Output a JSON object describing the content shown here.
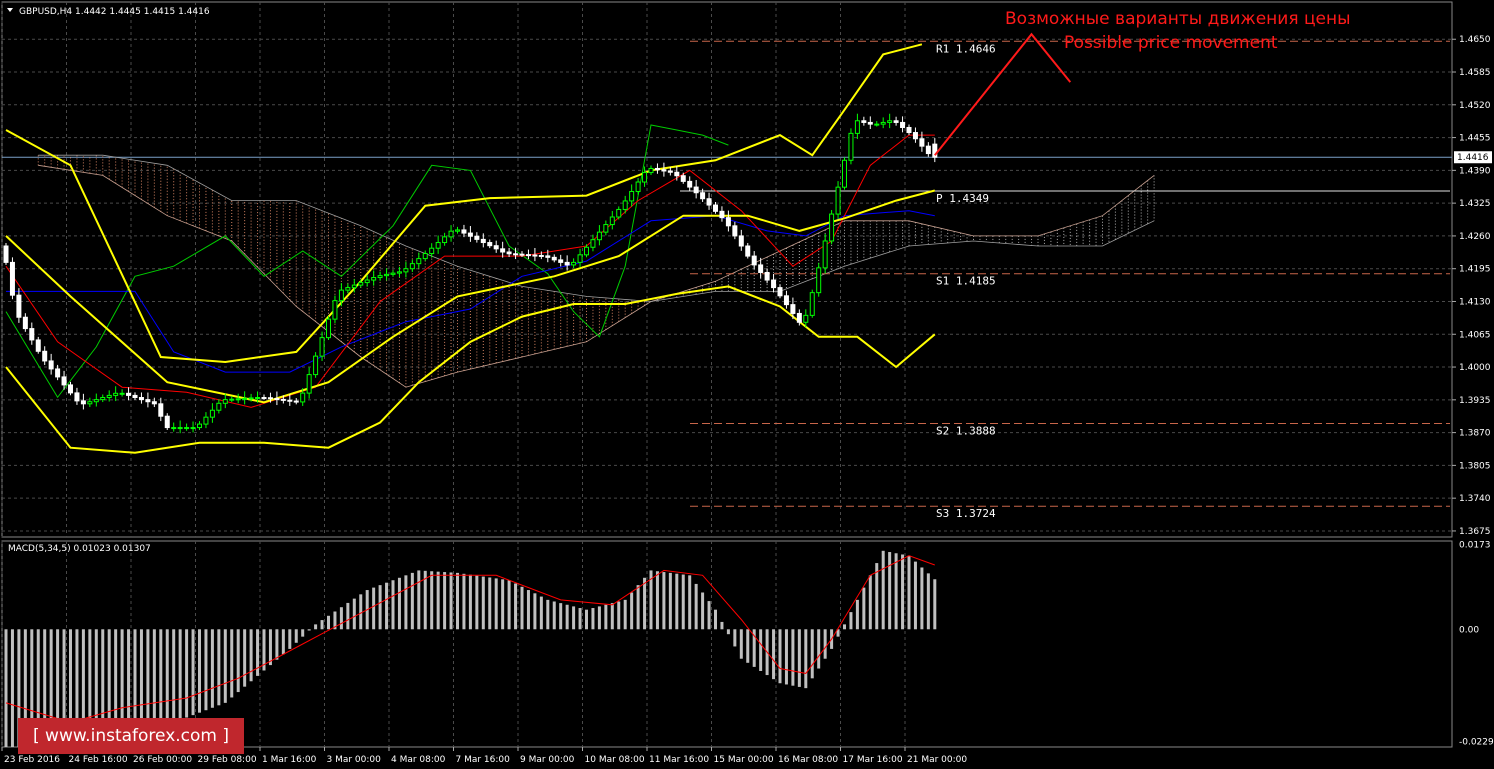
{
  "symbol_header": "GBPUSD,H4  1.4442 1.4445 1.4415 1.4416",
  "annotation": {
    "line_ru": "Возможные варианты движения цены",
    "line_en": "Possible price movement",
    "color": "#ff1a1a"
  },
  "watermark": "[ www.instaforex.com ]",
  "colors": {
    "background": "#000000",
    "grid": "#4a4a4a",
    "bull_candle": "#00ff00",
    "bear_candle": "#ffffff",
    "bollinger": "#ffff00",
    "tenkan": "#ff0000",
    "kijun": "#0000ff",
    "chikou": "#00cc00",
    "kumo_bull": "#b0b0b0",
    "kumo_bear": "#d08060",
    "pivot_lines": "#c8664a",
    "macd_hist": "#c0c0c0",
    "macd_signal": "#ff0000",
    "current_price_line": "#7aa0c8"
  },
  "chart_data": {
    "type": "candlestick",
    "symbol": "GBPUSD",
    "timeframe": "H4",
    "header_ohlc": {
      "open": 1.4442,
      "high": 1.4445,
      "low": 1.4415,
      "close": 1.4416
    },
    "current_price": 1.4416,
    "current_price_label": "1.4416",
    "price_axis": {
      "ylim": [
        1.3663,
        1.4704
      ],
      "ticks": [
        1.465,
        1.4585,
        1.452,
        1.4455,
        1.439,
        1.4325,
        1.426,
        1.4195,
        1.413,
        1.4065,
        1.4,
        1.3935,
        1.387,
        1.3805,
        1.374,
        1.3675
      ],
      "tick_labels": [
        "1.4650",
        "1.4585",
        "1.4520",
        "1.4455",
        "1.4390",
        "1.4325",
        "1.4260",
        "1.4195",
        "1.4130",
        "1.4065",
        "1.4000",
        "1.3935",
        "1.3870",
        "1.3805",
        "1.3740",
        "1.3675"
      ]
    },
    "time_axis": {
      "labels": [
        "23 Feb 2016",
        "24 Feb 16:00",
        "26 Feb 00:00",
        "29 Feb 08:00",
        "1 Mar 16:00",
        "3 Mar 00:00",
        "4 Mar 08:00",
        "7 Mar 16:00",
        "9 Mar 00:00",
        "10 Mar 08:00",
        "11 Mar 16:00",
        "15 Mar 00:00",
        "16 Mar 08:00",
        "17 Mar 16:00",
        "21 Mar 00:00"
      ],
      "label_bar_index": [
        0,
        10,
        20,
        30,
        40,
        50,
        60,
        70,
        80,
        90,
        100,
        110,
        120,
        130,
        140
      ],
      "bar_count": 145
    },
    "pivot_levels": [
      {
        "name": "R1",
        "value": 1.4646,
        "label": "R1 1.4646",
        "style": "dashed"
      },
      {
        "name": "P",
        "value": 1.4349,
        "label": "P 1.4349",
        "style": "solid"
      },
      {
        "name": "S1",
        "value": 1.4185,
        "label": "S1 1.4185",
        "style": "dashed"
      },
      {
        "name": "S2",
        "value": 1.3888,
        "label": "S2 1.3888",
        "style": "dashed"
      },
      {
        "name": "S3",
        "value": 1.3724,
        "label": "S3 1.3724",
        "style": "dashed"
      }
    ],
    "price_path_anchors": [
      [
        0,
        1.424
      ],
      [
        2,
        1.411
      ],
      [
        6,
        1.402
      ],
      [
        12,
        1.3925
      ],
      [
        18,
        1.395
      ],
      [
        24,
        1.3925
      ],
      [
        25,
        1.388
      ],
      [
        30,
        1.388
      ],
      [
        34,
        1.3935
      ],
      [
        40,
        1.394
      ],
      [
        46,
        1.393
      ],
      [
        52,
        1.415
      ],
      [
        58,
        1.418
      ],
      [
        62,
        1.419
      ],
      [
        66,
        1.423
      ],
      [
        70,
        1.4275
      ],
      [
        74,
        1.425
      ],
      [
        78,
        1.4225
      ],
      [
        84,
        1.422
      ],
      [
        88,
        1.42
      ],
      [
        92,
        1.426
      ],
      [
        96,
        1.432
      ],
      [
        100,
        1.4395
      ],
      [
        104,
        1.4385
      ],
      [
        108,
        1.434
      ],
      [
        112,
        1.429
      ],
      [
        116,
        1.421
      ],
      [
        120,
        1.415
      ],
      [
        124,
        1.408
      ],
      [
        126,
        1.417
      ],
      [
        129,
        1.433
      ],
      [
        132,
        1.449
      ],
      [
        135,
        1.448
      ],
      [
        138,
        1.449
      ],
      [
        141,
        1.446
      ],
      [
        144,
        1.4416
      ]
    ],
    "bollinger_bands": {
      "upper": [
        [
          0,
          1.447
        ],
        [
          10,
          1.44
        ],
        [
          24,
          1.402
        ],
        [
          34,
          1.401
        ],
        [
          45,
          1.403
        ],
        [
          55,
          1.417
        ],
        [
          65,
          1.432
        ],
        [
          75,
          1.4335
        ],
        [
          90,
          1.434
        ],
        [
          100,
          1.439
        ],
        [
          110,
          1.441
        ],
        [
          120,
          1.446
        ],
        [
          125,
          1.442
        ],
        [
          130,
          1.451
        ],
        [
          136,
          1.462
        ],
        [
          142,
          1.464
        ]
      ],
      "middle": [
        [
          0,
          1.426
        ],
        [
          10,
          1.414
        ],
        [
          25,
          1.397
        ],
        [
          40,
          1.393
        ],
        [
          50,
          1.397
        ],
        [
          60,
          1.406
        ],
        [
          70,
          1.414
        ],
        [
          85,
          1.418
        ],
        [
          95,
          1.422
        ],
        [
          105,
          1.43
        ],
        [
          115,
          1.43
        ],
        [
          123,
          1.427
        ],
        [
          130,
          1.4295
        ],
        [
          138,
          1.433
        ],
        [
          144,
          1.435
        ]
      ],
      "lower": [
        [
          0,
          1.4
        ],
        [
          10,
          1.384
        ],
        [
          20,
          1.383
        ],
        [
          30,
          1.385
        ],
        [
          40,
          1.385
        ],
        [
          50,
          1.384
        ],
        [
          58,
          1.389
        ],
        [
          64,
          1.397
        ],
        [
          72,
          1.405
        ],
        [
          80,
          1.41
        ],
        [
          88,
          1.4125
        ],
        [
          96,
          1.4125
        ],
        [
          104,
          1.4145
        ],
        [
          112,
          1.416
        ],
        [
          120,
          1.412
        ],
        [
          126,
          1.406
        ],
        [
          132,
          1.406
        ],
        [
          138,
          1.4
        ],
        [
          144,
          1.4065
        ]
      ]
    },
    "ichimoku": {
      "tenkan": [
        [
          0,
          1.42
        ],
        [
          8,
          1.405
        ],
        [
          18,
          1.396
        ],
        [
          28,
          1.395
        ],
        [
          38,
          1.392
        ],
        [
          48,
          1.396
        ],
        [
          58,
          1.413
        ],
        [
          68,
          1.422
        ],
        [
          80,
          1.422
        ],
        [
          90,
          1.424
        ],
        [
          98,
          1.433
        ],
        [
          106,
          1.439
        ],
        [
          114,
          1.431
        ],
        [
          122,
          1.42
        ],
        [
          128,
          1.425
        ],
        [
          134,
          1.44
        ],
        [
          140,
          1.446
        ],
        [
          144,
          1.446
        ]
      ],
      "kijun": [
        [
          0,
          1.415
        ],
        [
          20,
          1.415
        ],
        [
          26,
          1.403
        ],
        [
          34,
          1.399
        ],
        [
          44,
          1.399
        ],
        [
          52,
          1.404
        ],
        [
          62,
          1.409
        ],
        [
          72,
          1.4115
        ],
        [
          80,
          1.418
        ],
        [
          90,
          1.421
        ],
        [
          100,
          1.429
        ],
        [
          110,
          1.43
        ],
        [
          118,
          1.427
        ],
        [
          124,
          1.426
        ],
        [
          130,
          1.43
        ],
        [
          140,
          1.431
        ],
        [
          144,
          1.43
        ]
      ],
      "chikou": [
        [
          0,
          1.411
        ],
        [
          8,
          1.394
        ],
        [
          14,
          1.404
        ],
        [
          20,
          1.418
        ],
        [
          26,
          1.42
        ],
        [
          34,
          1.426
        ],
        [
          40,
          1.418
        ],
        [
          46,
          1.423
        ],
        [
          52,
          1.418
        ],
        [
          60,
          1.428
        ],
        [
          66,
          1.44
        ],
        [
          72,
          1.439
        ],
        [
          78,
          1.424
        ],
        [
          84,
          1.4185
        ],
        [
          88,
          1.411
        ],
        [
          92,
          1.406
        ],
        [
          96,
          1.42
        ],
        [
          100,
          1.448
        ],
        [
          104,
          1.447
        ],
        [
          108,
          1.446
        ],
        [
          112,
          1.444
        ]
      ],
      "span_a": [
        [
          5,
          1.44
        ],
        [
          15,
          1.438
        ],
        [
          25,
          1.43
        ],
        [
          35,
          1.425
        ],
        [
          45,
          1.412
        ],
        [
          55,
          1.402
        ],
        [
          62,
          1.396
        ],
        [
          70,
          1.399
        ],
        [
          80,
          1.402
        ],
        [
          90,
          1.405
        ],
        [
          100,
          1.413
        ],
        [
          110,
          1.417
        ],
        [
          120,
          1.423
        ],
        [
          130,
          1.429
        ],
        [
          140,
          1.429
        ],
        [
          150,
          1.426
        ],
        [
          160,
          1.426
        ],
        [
          170,
          1.43
        ],
        [
          178,
          1.438
        ]
      ],
      "span_b": [
        [
          5,
          1.442
        ],
        [
          15,
          1.442
        ],
        [
          25,
          1.44
        ],
        [
          35,
          1.433
        ],
        [
          45,
          1.433
        ],
        [
          55,
          1.428
        ],
        [
          62,
          1.424
        ],
        [
          70,
          1.42
        ],
        [
          80,
          1.416
        ],
        [
          90,
          1.414
        ],
        [
          100,
          1.413
        ],
        [
          110,
          1.415
        ],
        [
          120,
          1.415
        ],
        [
          130,
          1.42
        ],
        [
          140,
          1.424
        ],
        [
          150,
          1.425
        ],
        [
          160,
          1.424
        ],
        [
          170,
          1.424
        ],
        [
          178,
          1.429
        ]
      ]
    },
    "forecast_arrow": {
      "points": [
        [
          0,
          1.442
        ],
        [
          15,
          1.466
        ],
        [
          21,
          1.4565
        ]
      ],
      "start_bar": 144
    },
    "macd": {
      "label": "MACD(5,34,5) 0.01023 0.01307",
      "params": [
        5,
        34,
        5
      ],
      "main_value": 0.01023,
      "signal_value": 0.01307,
      "ylim": [
        -0.024,
        0.018
      ],
      "ticks": [
        0.0173,
        0.0,
        -0.02292
      ],
      "tick_labels": [
        "0.0173",
        "0.00",
        "-0.02292"
      ],
      "histogram_anchors": [
        [
          0,
          -0.024
        ],
        [
          12,
          -0.024
        ],
        [
          24,
          -0.02
        ],
        [
          34,
          -0.015
        ],
        [
          44,
          -0.004
        ],
        [
          48,
          0.001
        ],
        [
          56,
          0.008
        ],
        [
          64,
          0.012
        ],
        [
          70,
          0.0115
        ],
        [
          78,
          0.01
        ],
        [
          84,
          0.006
        ],
        [
          90,
          0.004
        ],
        [
          96,
          0.006
        ],
        [
          100,
          0.012
        ],
        [
          106,
          0.011
        ],
        [
          110,
          0.004
        ],
        [
          114,
          -0.006
        ],
        [
          120,
          -0.011
        ],
        [
          124,
          -0.012
        ],
        [
          128,
          -0.004
        ],
        [
          132,
          0.006
        ],
        [
          136,
          0.016
        ],
        [
          140,
          0.015
        ],
        [
          144,
          0.0102
        ]
      ],
      "signal_anchors": [
        [
          0,
          -0.015
        ],
        [
          10,
          -0.019
        ],
        [
          18,
          -0.016
        ],
        [
          28,
          -0.014
        ],
        [
          36,
          -0.01
        ],
        [
          46,
          -0.003
        ],
        [
          56,
          0.004
        ],
        [
          66,
          0.011
        ],
        [
          76,
          0.011
        ],
        [
          86,
          0.006
        ],
        [
          94,
          0.005
        ],
        [
          102,
          0.012
        ],
        [
          108,
          0.011
        ],
        [
          114,
          0.002
        ],
        [
          120,
          -0.008
        ],
        [
          124,
          -0.009
        ],
        [
          128,
          -0.002
        ],
        [
          134,
          0.011
        ],
        [
          140,
          0.015
        ],
        [
          144,
          0.0131
        ]
      ]
    }
  }
}
